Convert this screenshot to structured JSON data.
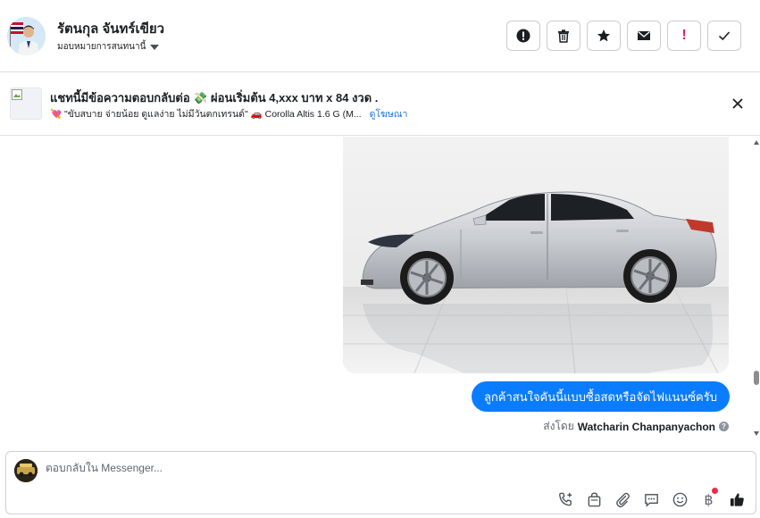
{
  "header": {
    "contact_name": "รัตนกุล จันทร์เขียว",
    "assign_label": "มอบหมายการสนทนานี้",
    "actions": [
      {
        "name": "report-button",
        "icon": "alert-circle-icon"
      },
      {
        "name": "delete-button",
        "icon": "trash-icon"
      },
      {
        "name": "star-button",
        "icon": "star-icon"
      },
      {
        "name": "mark-unread-button",
        "icon": "envelope-icon"
      },
      {
        "name": "spam-button",
        "icon": "exclamation-icon",
        "label": "!"
      },
      {
        "name": "mark-done-button",
        "icon": "check-icon"
      }
    ]
  },
  "ad": {
    "title": "แชทนี้มีข้อความตอบกลับต่อ 💸 ผ่อนเริ่มต้น 4,xxx บาท x 84 งวด .",
    "description": "💘 \"ขับสบาย จ่ายน้อย ดูแลง่าย ไม่มีวันตกเทรนด์\" 🚗 Corolla Altis 1.6 G (M...",
    "link_label": "ดูโฆษณา"
  },
  "conversation": {
    "message_text": "ลูกค้าสนใจคันนี้แบบซื้อสดหรือจัดไฟแนนซ์ครับ",
    "sent_by_prefix": "ส่งโดย",
    "sent_by_name": "Watcharin Chanpanyachon",
    "help_icon_label": "?"
  },
  "composer": {
    "placeholder": "ตอบกลับใน Messenger...",
    "baht_symbol": "฿"
  },
  "colors": {
    "accent": "#0a7cff",
    "link": "#1b74e4",
    "alert_red": "#e0245e",
    "notification_dot": "#f02849"
  }
}
